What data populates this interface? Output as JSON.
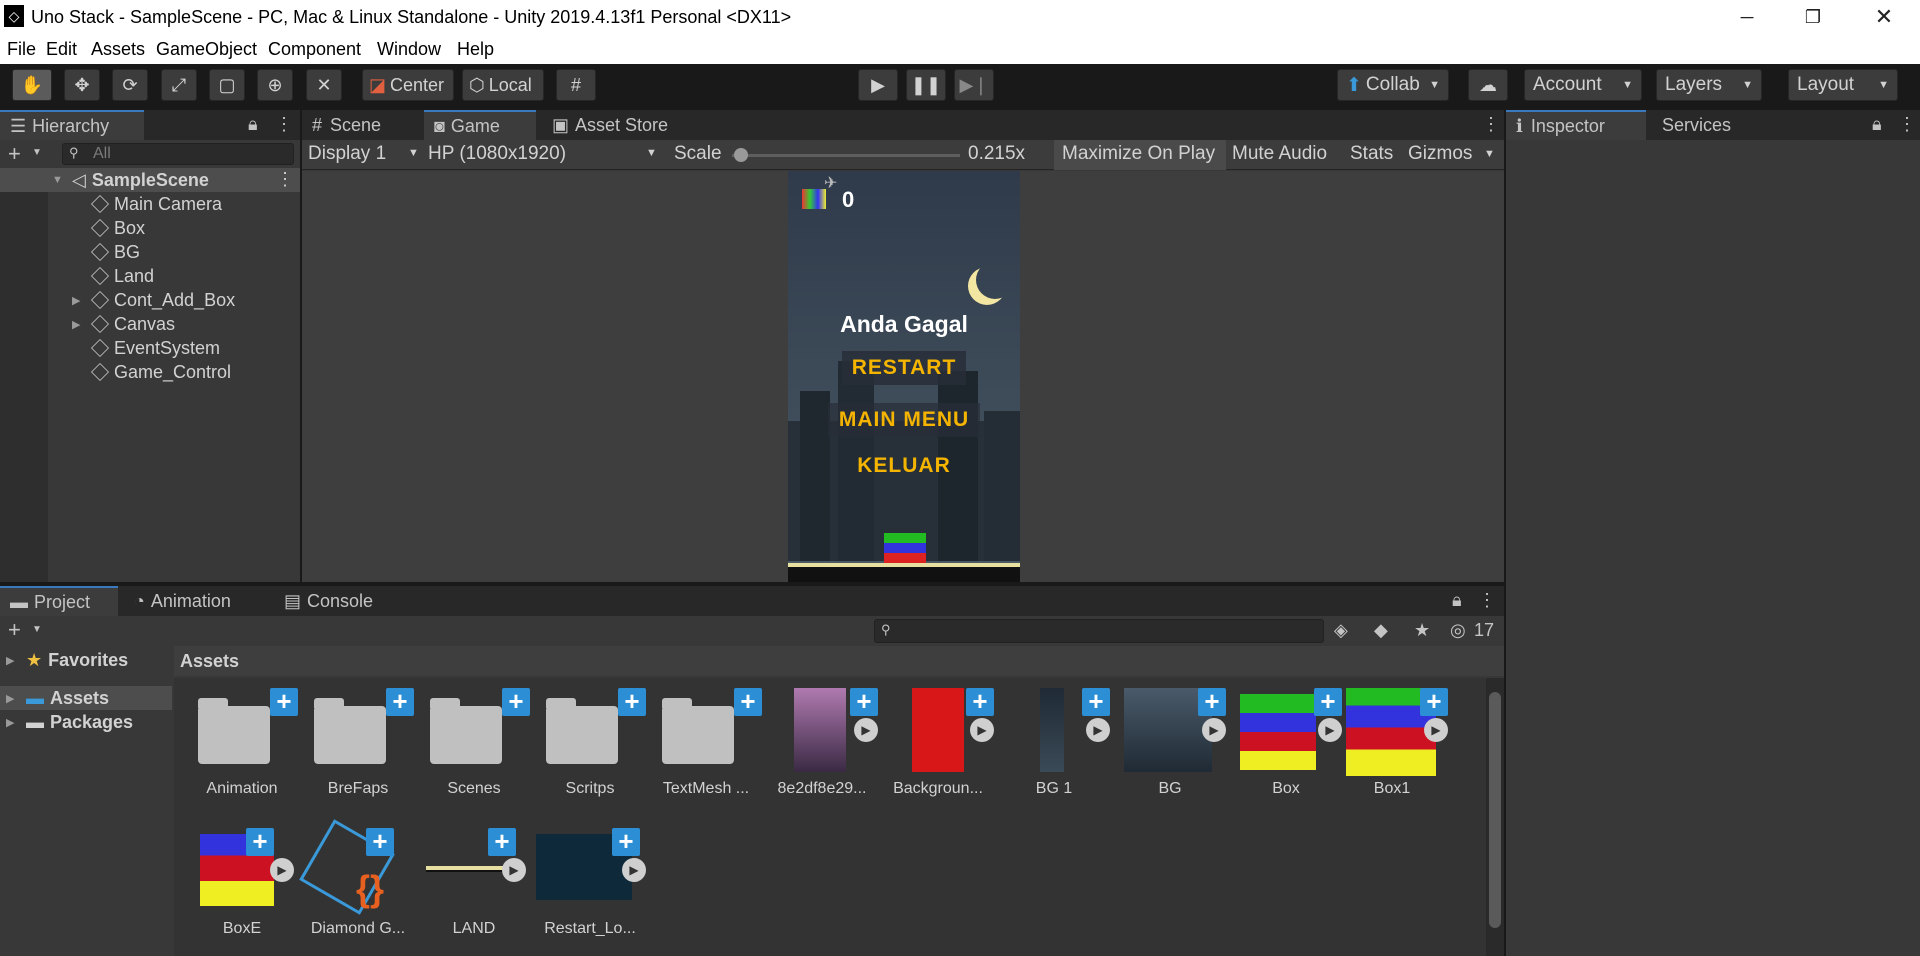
{
  "window": {
    "title": "Uno Stack - SampleScene - PC, Mac & Linux Standalone - Unity 2019.4.13f1 Personal <DX11>"
  },
  "menu": [
    "File",
    "Edit",
    "Assets",
    "GameObject",
    "Component",
    "Window",
    "Help"
  ],
  "toolbar": {
    "center": "Center",
    "local": "Local",
    "collab": "Collab",
    "account": "Account",
    "layers": "Layers",
    "layout": "Layout"
  },
  "hierarchy": {
    "tab": "Hierarchy",
    "search_placeholder": "All",
    "scene": "SampleScene",
    "items": [
      "Main Camera",
      "Box",
      "BG",
      "Land",
      "Cont_Add_Box",
      "Canvas",
      "EventSystem",
      "Game_Control"
    ]
  },
  "game_view": {
    "tabs": [
      "Scene",
      "Game",
      "Asset Store"
    ],
    "display": "Display 1",
    "resolution": "HP (1080x1920)",
    "scale_label": "Scale",
    "scale_value": "0.215x",
    "maximize": "Maximize On Play",
    "mute": "Mute Audio",
    "stats": "Stats",
    "gizmos": "Gizmos",
    "score": "0",
    "fail_text": "Anda Gagal",
    "restart": "RESTART",
    "main_menu": "MAIN MENU",
    "keluar": "KELUAR"
  },
  "inspector": {
    "tabs": [
      "Inspector",
      "Services"
    ]
  },
  "project": {
    "tabs": [
      "Project",
      "Animation",
      "Console"
    ],
    "favorites": "Favorites",
    "assets_tree": "Assets",
    "packages": "Packages",
    "breadcrumb": "Assets",
    "hidden_count": "17",
    "assets": [
      {
        "name": "Animation",
        "kind": "folder"
      },
      {
        "name": "BreFaps",
        "kind": "folder"
      },
      {
        "name": "Scenes",
        "kind": "folder"
      },
      {
        "name": "Scritps",
        "kind": "folder"
      },
      {
        "name": "TextMesh ...",
        "kind": "folder"
      },
      {
        "name": "8e2df8e29...",
        "kind": "image"
      },
      {
        "name": "Backgroun...",
        "kind": "image"
      },
      {
        "name": "BG 1",
        "kind": "image"
      },
      {
        "name": "BG",
        "kind": "image"
      },
      {
        "name": "Box",
        "kind": "image"
      },
      {
        "name": "Box1",
        "kind": "image"
      },
      {
        "name": "BoxE",
        "kind": "image"
      },
      {
        "name": "Diamond G...",
        "kind": "script"
      },
      {
        "name": "LAND",
        "kind": "image"
      },
      {
        "name": "Restart_Lo...",
        "kind": "image"
      }
    ]
  },
  "colors": {
    "accent": "#3a79bb",
    "button_text": "#f5b400",
    "plus": "#2c8fd6"
  }
}
